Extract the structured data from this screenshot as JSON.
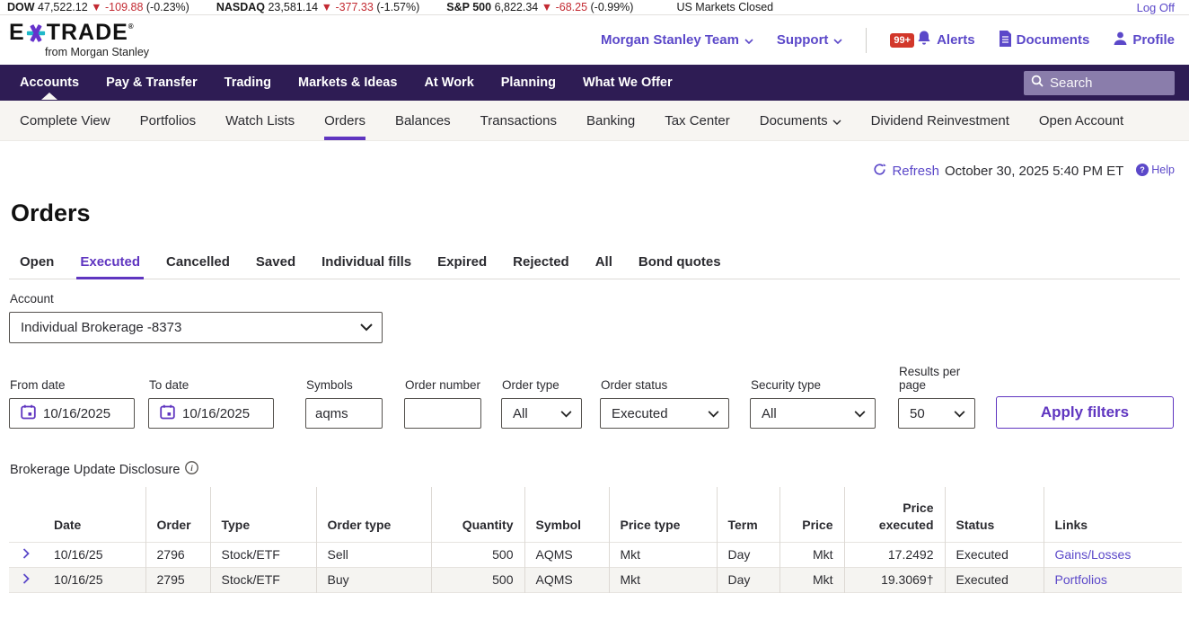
{
  "colors": {
    "accent": "#5b48c9",
    "active_underline": "#5f35c0",
    "nav_background": "#2e1c54",
    "subnav_background": "#f7f5f2",
    "negative_red": "#c32a32",
    "badge_red": "#d2372a",
    "logo_teal": "#1fb8c9",
    "logo_purple": "#6633cc"
  },
  "ticker": {
    "indices": [
      {
        "label": "DOW",
        "value": "47,522.12",
        "arrow": "▼",
        "change": "-109.88",
        "percent": "(-0.23%)"
      },
      {
        "label": "NASDAQ",
        "value": "23,581.14",
        "arrow": "▼",
        "change": "-377.33",
        "percent": "(-1.57%)"
      },
      {
        "label": "S&P 500",
        "value": "6,822.34",
        "arrow": "▼",
        "change": "-68.25",
        "percent": "(-0.99%)"
      }
    ],
    "market_status": "US Markets Closed",
    "log_off_label": "Log Off"
  },
  "header": {
    "logo_pre": "E",
    "logo_post": "TRADE",
    "logo_registered": "®",
    "logo_tagline": "from Morgan Stanley",
    "team_menu_label": "Morgan Stanley Team",
    "support_menu_label": "Support",
    "alerts_badge": "99+",
    "alerts_label": "Alerts",
    "documents_label": "Documents",
    "profile_label": "Profile"
  },
  "nav": {
    "items": [
      "Accounts",
      "Pay & Transfer",
      "Trading",
      "Markets & Ideas",
      "At Work",
      "Planning",
      "What We Offer"
    ],
    "active_item": "Accounts",
    "search_placeholder": "Search"
  },
  "subnav": {
    "items": [
      {
        "label": "Complete View"
      },
      {
        "label": "Portfolios"
      },
      {
        "label": "Watch Lists"
      },
      {
        "label": "Orders"
      },
      {
        "label": "Balances"
      },
      {
        "label": "Transactions"
      },
      {
        "label": "Banking"
      },
      {
        "label": "Tax Center"
      },
      {
        "label": "Documents",
        "has_dropdown": true
      },
      {
        "label": "Dividend Reinvestment"
      },
      {
        "label": "Open Account"
      }
    ],
    "active_item": "Orders"
  },
  "toolbar": {
    "refresh_label": "Refresh",
    "timestamp": "October 30, 2025 5:40 PM ET",
    "help_label": "Help"
  },
  "page": {
    "title": "Orders"
  },
  "tabs": {
    "items": [
      "Open",
      "Executed",
      "Cancelled",
      "Saved",
      "Individual fills",
      "Expired",
      "Rejected",
      "All",
      "Bond quotes"
    ],
    "active": "Executed"
  },
  "filters": {
    "account": {
      "label": "Account",
      "value": "Individual Brokerage -8373"
    },
    "from_date": {
      "label": "From date",
      "value": "10/16/2025"
    },
    "to_date": {
      "label": "To date",
      "value": "10/16/2025"
    },
    "symbols": {
      "label": "Symbols",
      "value": "aqms"
    },
    "order_number": {
      "label": "Order number",
      "value": ""
    },
    "order_type": {
      "label": "Order type",
      "value": "All"
    },
    "order_status": {
      "label": "Order status",
      "value": "Executed"
    },
    "security_type": {
      "label": "Security type",
      "value": "All"
    },
    "results_per_page": {
      "label": "Results per page",
      "value": "50"
    },
    "apply_button_label": "Apply filters"
  },
  "disclosure": {
    "label": "Brokerage Update Disclosure"
  },
  "orders_table": {
    "columns": [
      {
        "key": "expand",
        "label": "",
        "align": "left"
      },
      {
        "key": "date",
        "label": "Date",
        "align": "left"
      },
      {
        "key": "order",
        "label": "Order",
        "align": "left"
      },
      {
        "key": "type",
        "label": "Type",
        "align": "left"
      },
      {
        "key": "order_type",
        "label": "Order type",
        "align": "left"
      },
      {
        "key": "quantity",
        "label": "Quantity",
        "align": "right"
      },
      {
        "key": "symbol",
        "label": "Symbol",
        "align": "left"
      },
      {
        "key": "price_type",
        "label": "Price type",
        "align": "left"
      },
      {
        "key": "term",
        "label": "Term",
        "align": "left"
      },
      {
        "key": "price",
        "label": "Price",
        "align": "right"
      },
      {
        "key": "price_executed",
        "label": "Price executed",
        "align": "right"
      },
      {
        "key": "status",
        "label": "Status",
        "align": "left"
      },
      {
        "key": "links",
        "label": "Links",
        "align": "left"
      }
    ],
    "rows": [
      {
        "date": "10/16/25",
        "order": "2796",
        "type": "Stock/ETF",
        "order_type": "Sell",
        "quantity": "500",
        "symbol": "AQMS",
        "price_type": "Mkt",
        "term": "Day",
        "price": "Mkt",
        "price_executed": "17.2492",
        "status": "Executed",
        "link_label": "Gains/Losses"
      },
      {
        "date": "10/16/25",
        "order": "2795",
        "type": "Stock/ETF",
        "order_type": "Buy",
        "quantity": "500",
        "symbol": "AQMS",
        "price_type": "Mkt",
        "term": "Day",
        "price": "Mkt",
        "price_executed": "19.3069†",
        "status": "Executed",
        "link_label": "Portfolios"
      }
    ]
  }
}
